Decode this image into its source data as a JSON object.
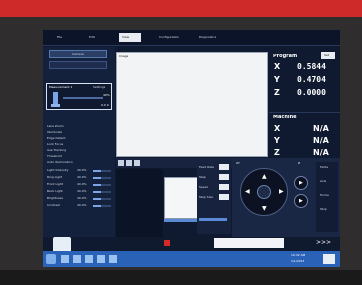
{
  "menu": {
    "tabs": [
      {
        "label": "File"
      },
      {
        "label": "Edit"
      },
      {
        "label": "View"
      },
      {
        "label": "Configuration"
      },
      {
        "label": "Diagnostics"
      }
    ]
  },
  "toolbar": {
    "label": "Camera"
  },
  "left_panel": {
    "header": "Camera",
    "lens_title": "Measurement 1",
    "lens_button": "Settings",
    "lens_value": "40%",
    "lens_value2": "0.0 X",
    "options": [
      {
        "label": "Lens Zoom"
      },
      {
        "label": "Illuminate"
      },
      {
        "label": "Edge Detect"
      },
      {
        "label": "Lock Focus"
      },
      {
        "label": "Use Tracking"
      },
      {
        "label": "Threshold"
      },
      {
        "label": "Auto Illumination"
      }
    ],
    "sliders": [
      {
        "label": "Light Intensity",
        "value": "40.0%",
        "fill": 0.45
      },
      {
        "label": "Ring Light",
        "value": "40.0%",
        "fill": 0.45
      },
      {
        "label": "Front Light",
        "value": "40.0%",
        "fill": 0.45
      },
      {
        "label": "Back Light",
        "value": "40.0%",
        "fill": 0.45
      },
      {
        "label": "Brightness",
        "value": "40.0%",
        "fill": 0.45
      },
      {
        "label": "Contrast",
        "value": "40.0%",
        "fill": 0.45
      }
    ]
  },
  "view": {
    "image_label": "Image"
  },
  "program": {
    "title": "Program",
    "button": "Set",
    "coords": [
      {
        "axis": "X",
        "value": "0.5844"
      },
      {
        "axis": "Y",
        "value": "0.4704"
      },
      {
        "axis": "Z",
        "value": "0.0000"
      }
    ]
  },
  "machine": {
    "title": "Machine",
    "coords": [
      {
        "axis": "X",
        "value": "N/A"
      },
      {
        "axis": "Y",
        "value": "N/A"
      },
      {
        "axis": "Z",
        "value": "N/A"
      }
    ]
  },
  "jog": {
    "fields": [
      {
        "label": "Feed Rate",
        "value": "1.0"
      },
      {
        "label": "Step",
        "value": "0.1"
      },
      {
        "label": "Speed",
        "value": "100"
      },
      {
        "label": "Step Size",
        "value": "0.01"
      }
    ],
    "xyz_label": "XY",
    "z_label": "Z",
    "side_buttons": [
      {
        "label": "Mode"
      },
      {
        "label": "Axis"
      },
      {
        "label": "Home"
      },
      {
        "label": "Stop"
      }
    ]
  },
  "footer": {
    "arrow": ">>>"
  },
  "taskbar": {
    "time": "10:32 AM",
    "date": "1/1/2016"
  },
  "colors": {
    "bezel": "#cf2a2a",
    "ui_bg": "#0f1a30",
    "panel": "#1c2a48",
    "accent": "#5a8ad6",
    "taskbar": "#2a62b8"
  }
}
